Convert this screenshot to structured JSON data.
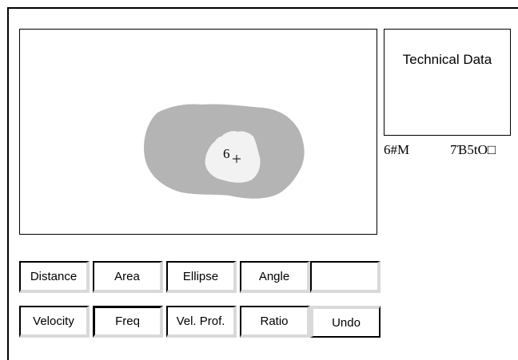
{
  "tech_panel": {
    "title": "Technical Data",
    "readout_left": "6#M",
    "readout_right": "7Ɓ5tO□"
  },
  "image_view": {
    "region_label": "6",
    "outer_region_color": "#b4b4b4",
    "inner_region_color": "#f2f2f2",
    "cursor_icon": "crosshair-icon"
  },
  "buttons": {
    "distance": "Distance",
    "area": "Area",
    "ellipse": "Ellipse",
    "angle": "Angle",
    "blank": "",
    "velocity": "Velocity",
    "freq": "Freq",
    "vel_prof": "Vel. Prof.",
    "ratio": "Ratio",
    "undo": "Undo"
  }
}
